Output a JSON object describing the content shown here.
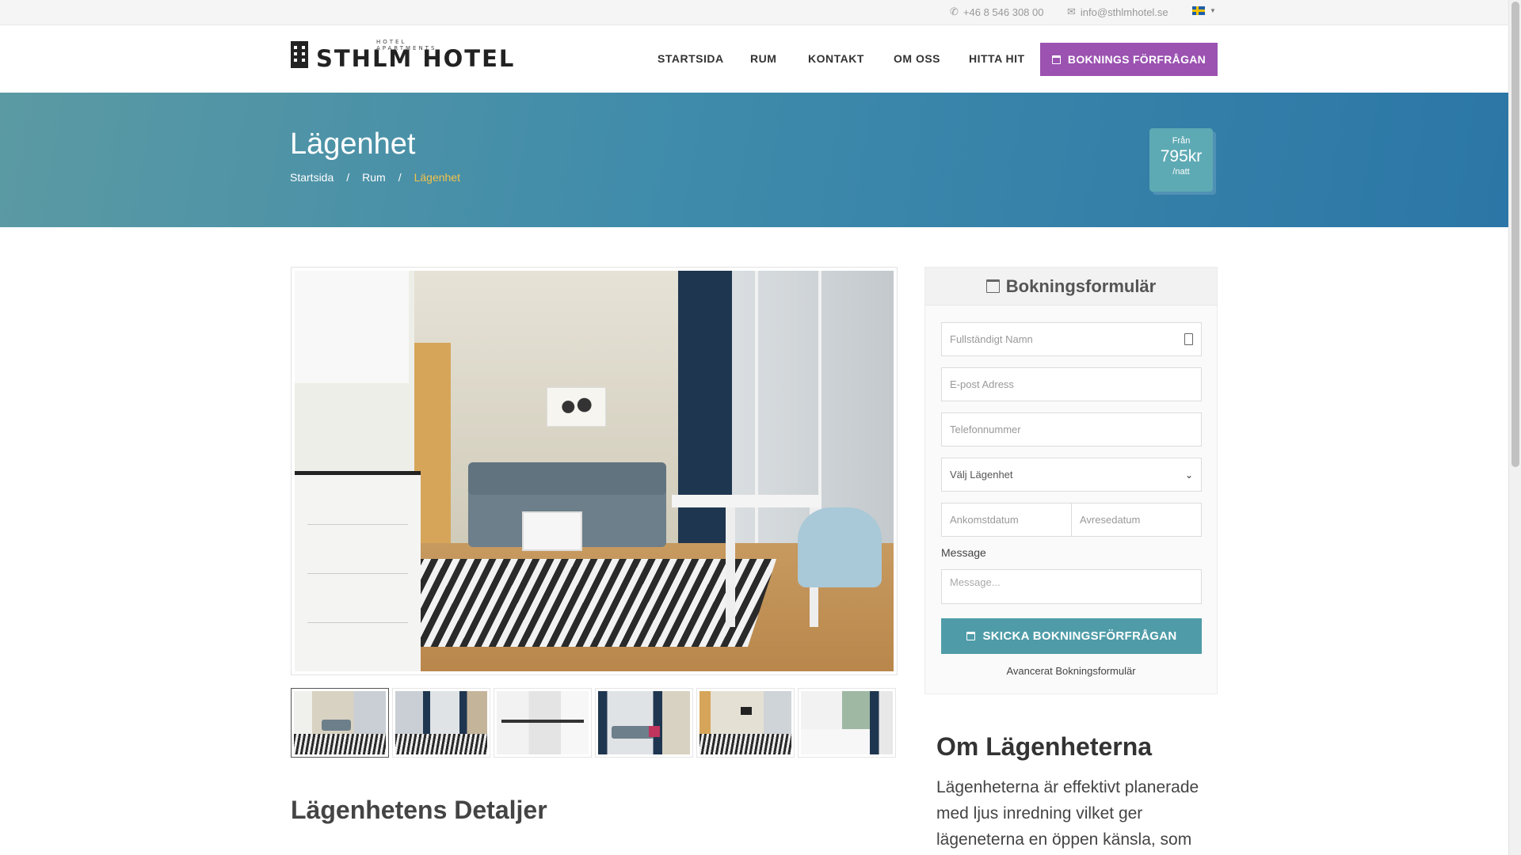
{
  "topbar": {
    "phone": "+46 8 546 308 00",
    "email": "info@sthlmhotel.se",
    "language_icon": "swedish-flag-icon"
  },
  "logo": {
    "tagline": "HOTEL APARTMENTS",
    "name": "STHLM  HOTEL"
  },
  "nav": {
    "items": [
      "STARTSIDA",
      "RUM",
      "KONTAKT",
      "OM OSS",
      "HITTA HIT"
    ],
    "cta": "BOKNINGS FÖRFRÅGAN"
  },
  "hero": {
    "title": "Lägenhet",
    "breadcrumbs": [
      "Startsida",
      "Rum",
      "Lägenhet"
    ],
    "price": {
      "from": "Från",
      "amount": "795kr",
      "per": "/natt"
    }
  },
  "form": {
    "title": "Bokningsformulär",
    "name_placeholder": "Fullständigt Namn",
    "email_placeholder": "E-post Adress",
    "phone_placeholder": "Telefonnummer",
    "apartment_select": "Välj Lägenhet",
    "arrival_placeholder": "Ankomstdatum",
    "departure_placeholder": "Avresedatum",
    "message_label": "Message",
    "message_placeholder": "Message...",
    "submit": "SKICKA BOKNINGSFÖRFRÅGAN",
    "advanced_link": "Avancerat Bokningsformulär"
  },
  "details": {
    "heading": "Lägenhetens Detaljer"
  },
  "about": {
    "heading": "Om Lägenheterna",
    "text": "Lägenheterna är effektivt planerade med ljus inredning vilket ger lägeneterna en öppen känsla, som"
  },
  "colors": {
    "accent_purple": "#9b52b1",
    "hero_start": "#5b9aa3",
    "hero_end": "#2b76a6",
    "breadcrumb_active": "#f4c24a",
    "submit": "#4f9ca8"
  }
}
